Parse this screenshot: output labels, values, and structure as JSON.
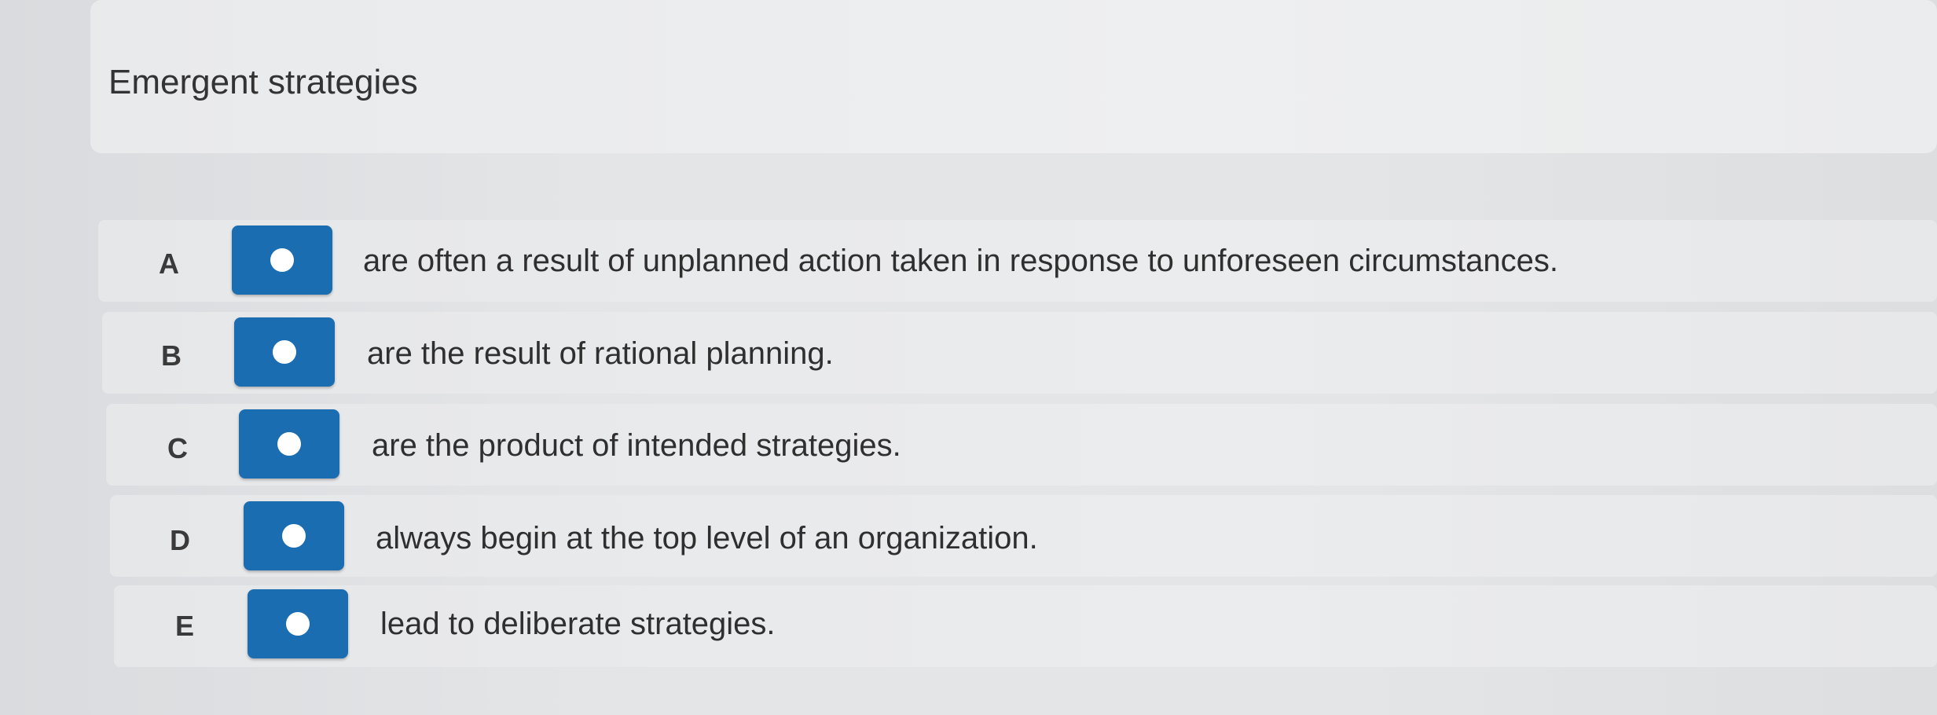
{
  "question": {
    "title": "Emergent strategies"
  },
  "choices": [
    {
      "letter": "A",
      "text": "are often a result of unplanned action taken in response to unforeseen circumstances.",
      "selected": false
    },
    {
      "letter": "B",
      "text": "are the result of rational planning.",
      "selected": false
    },
    {
      "letter": "C",
      "text": "are the product of intended strategies.",
      "selected": false
    },
    {
      "letter": "D",
      "text": "always begin at the top level of an organization.",
      "selected": false
    },
    {
      "letter": "E",
      "text": "lead to deliberate strategies.",
      "selected": false
    }
  ],
  "colors": {
    "radio_background": "#1b6db2",
    "radio_dot": "#ffffff",
    "page_background": "#e3e5e7"
  }
}
